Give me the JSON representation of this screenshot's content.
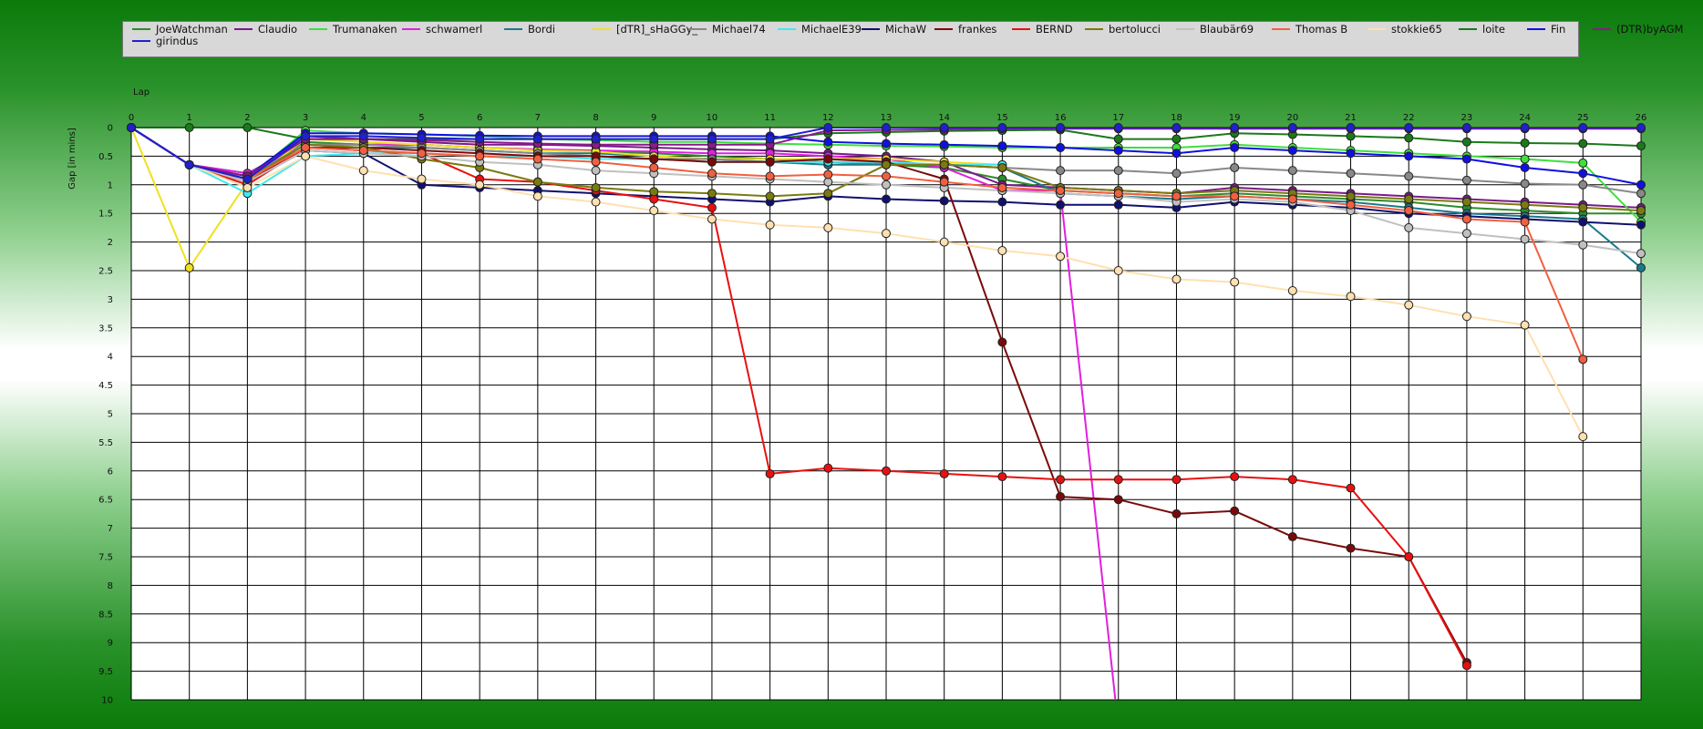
{
  "chart_data": {
    "type": "line",
    "xlabel": "Lap",
    "ylabel": "Gap [in mins]",
    "x": [
      0,
      1,
      2,
      3,
      4,
      5,
      6,
      7,
      8,
      9,
      10,
      11,
      12,
      13,
      14,
      15,
      16,
      17,
      18,
      19,
      20,
      21,
      22,
      23,
      24,
      25,
      26
    ],
    "xlim": [
      0,
      26
    ],
    "ylim": [
      0,
      10
    ],
    "y_inverted": true,
    "y_ticks": [
      "0",
      "0.5",
      "1",
      "1.5",
      "2",
      "2.5",
      "3",
      "3.5",
      "4",
      "4.5",
      "5",
      "5.5",
      "6",
      "6.5",
      "7",
      "7.5",
      "8",
      "8.5",
      "9",
      "9.5",
      "10"
    ],
    "grid": true,
    "legend_position": "top",
    "series": [
      {
        "name": "JoeWatchman",
        "color": "#2e8b2e",
        "values": [
          0,
          0.65,
          0.8,
          0.25,
          0.3,
          0.3,
          0.35,
          0.4,
          0.42,
          0.45,
          0.5,
          0.55,
          0.6,
          0.65,
          0.7,
          0.9,
          1.1,
          1.15,
          1.2,
          1.15,
          1.2,
          1.25,
          1.3,
          1.4,
          1.45,
          1.5,
          1.5
        ]
      },
      {
        "name": "Claudio",
        "color": "#7a1a8a",
        "values": [
          0,
          0.65,
          0.85,
          0.15,
          0.2,
          0.25,
          0.3,
          0.3,
          0.32,
          0.35,
          0.38,
          0.4,
          0.45,
          0.5,
          0.6,
          1.0,
          1.05,
          1.1,
          1.15,
          1.05,
          1.1,
          1.15,
          1.2,
          1.25,
          1.3,
          1.35,
          1.4
        ]
      },
      {
        "name": "Trumanaken",
        "color": "#3de03d",
        "values": [
          0,
          0.65,
          0.9,
          0.05,
          0.1,
          0.12,
          0.15,
          0.2,
          0.22,
          0.25,
          0.25,
          0.28,
          0.3,
          0.32,
          0.33,
          0.35,
          0.35,
          0.35,
          0.35,
          0.3,
          0.35,
          0.4,
          0.45,
          0.5,
          0.55,
          0.62,
          1.65
        ]
      },
      {
        "name": "schwamerl",
        "color": "#e020e0",
        "values": [
          0,
          0.65,
          0.8,
          0.3,
          0.3,
          0.3,
          0.35,
          0.38,
          0.4,
          0.42,
          0.45,
          0.45,
          0.5,
          0.55,
          0.7,
          1.1,
          1.1,
          10.5,
          null,
          null,
          null,
          null,
          null,
          null,
          null,
          null,
          null
        ]
      },
      {
        "name": "Bordi",
        "color": "#1a7a8a",
        "values": [
          0,
          0.65,
          0.9,
          0.3,
          0.35,
          0.35,
          0.4,
          0.45,
          0.45,
          0.5,
          0.55,
          0.6,
          0.65,
          0.65,
          0.65,
          0.7,
          1.15,
          1.2,
          1.25,
          1.2,
          1.25,
          1.3,
          1.4,
          1.5,
          1.55,
          1.6,
          2.45
        ]
      },
      {
        "name": "[dTR]_sHaGGy_",
        "color": "#f0e020",
        "values": [
          0,
          2.45,
          0.95,
          0.2,
          0.25,
          0.3,
          0.35,
          0.4,
          0.42,
          0.5,
          0.55,
          0.55,
          0.55,
          0.55,
          0.6,
          0.65,
          null,
          null,
          null,
          null,
          null,
          null,
          null,
          null,
          null,
          null,
          null
        ]
      },
      {
        "name": "Michael74",
        "color": "#888888",
        "values": [
          0,
          0.65,
          0.85,
          0.3,
          0.3,
          0.35,
          0.4,
          0.45,
          0.5,
          0.55,
          0.55,
          0.6,
          0.6,
          0.62,
          0.65,
          0.7,
          0.75,
          0.75,
          0.8,
          0.7,
          0.75,
          0.8,
          0.85,
          0.92,
          0.98,
          1.0,
          1.15
        ]
      },
      {
        "name": "MichaelE39",
        "color": "#40e8f0",
        "values": [
          0,
          0.65,
          1.15,
          0.5,
          0.45,
          0.45,
          0.5,
          0.5,
          0.55,
          0.55,
          0.6,
          0.6,
          0.6,
          0.6,
          0.65,
          0.65,
          null,
          null,
          null,
          null,
          null,
          null,
          null,
          null,
          null,
          null,
          null
        ]
      },
      {
        "name": "MichaW",
        "color": "#101070",
        "values": [
          0,
          0.65,
          0.95,
          0.4,
          0.45,
          1.0,
          1.05,
          1.1,
          1.15,
          1.2,
          1.25,
          1.3,
          1.2,
          1.25,
          1.28,
          1.3,
          1.35,
          1.35,
          1.4,
          1.3,
          1.35,
          1.4,
          1.5,
          1.55,
          1.6,
          1.65,
          1.7
        ]
      },
      {
        "name": "frankes",
        "color": "#7a0a0a",
        "values": [
          0,
          0.65,
          0.95,
          0.35,
          0.35,
          0.4,
          0.45,
          0.5,
          0.5,
          0.55,
          0.6,
          0.6,
          0.55,
          0.6,
          0.9,
          3.75,
          6.45,
          6.5,
          6.75,
          6.7,
          7.15,
          7.35,
          7.5,
          9.35,
          null,
          null,
          null
        ]
      },
      {
        "name": "BERND",
        "color": "#e81010",
        "values": [
          0,
          0.65,
          1.0,
          0.35,
          0.4,
          0.45,
          0.9,
          0.95,
          1.1,
          1.25,
          1.4,
          6.05,
          5.95,
          6.0,
          6.05,
          6.1,
          6.15,
          6.15,
          6.15,
          6.1,
          6.15,
          6.3,
          7.5,
          9.4,
          null,
          null,
          null
        ]
      },
      {
        "name": "bertolucci",
        "color": "#7a7a10",
        "values": [
          0,
          0.65,
          0.9,
          0.3,
          0.35,
          0.55,
          0.7,
          0.95,
          1.05,
          1.12,
          1.15,
          1.2,
          1.15,
          0.65,
          0.65,
          0.7,
          1.05,
          1.1,
          1.15,
          1.1,
          1.15,
          1.2,
          1.25,
          1.3,
          1.35,
          1.4,
          1.45
        ]
      },
      {
        "name": "Blaubär69",
        "color": "#c0c0c0",
        "values": [
          0,
          0.65,
          0.95,
          0.4,
          0.45,
          0.5,
          0.6,
          0.65,
          0.75,
          0.8,
          0.85,
          0.9,
          0.95,
          1.0,
          1.05,
          1.1,
          1.15,
          1.2,
          1.3,
          1.25,
          1.3,
          1.45,
          1.75,
          1.85,
          1.95,
          2.05,
          2.2
        ]
      },
      {
        "name": "Thomas B",
        "color": "#f06040",
        "values": [
          0,
          0.65,
          0.9,
          0.35,
          0.4,
          0.45,
          0.5,
          0.55,
          0.6,
          0.7,
          0.8,
          0.85,
          0.82,
          0.85,
          0.95,
          1.05,
          1.1,
          1.15,
          1.2,
          1.2,
          1.25,
          1.35,
          1.45,
          1.6,
          1.65,
          4.05,
          null
        ]
      },
      {
        "name": "stokkie65",
        "color": "#ffe0b0",
        "values": [
          0,
          0.65,
          1.05,
          0.5,
          0.75,
          0.9,
          1.0,
          1.2,
          1.3,
          1.45,
          1.6,
          1.7,
          1.75,
          1.85,
          2.0,
          2.15,
          2.25,
          2.5,
          2.65,
          2.7,
          2.85,
          2.95,
          3.1,
          3.3,
          3.45,
          5.4,
          null
        ]
      },
      {
        "name": "loite",
        "color": "#1a7a1a",
        "values": [
          0,
          0,
          0,
          0.2,
          0.2,
          0.2,
          0.2,
          0.2,
          0.2,
          0.2,
          0.2,
          0.2,
          0.1,
          0.08,
          0.06,
          0.05,
          0.04,
          0.2,
          0.2,
          0.1,
          0.12,
          0.15,
          0.18,
          0.25,
          0.27,
          0.28,
          0.32
        ]
      },
      {
        "name": "Fin",
        "color": "#1010e0",
        "values": [
          0,
          0.65,
          0.85,
          0.1,
          0.1,
          0.12,
          0.14,
          0.15,
          0.15,
          0.15,
          0.15,
          0.15,
          0.25,
          0.28,
          0.3,
          0.32,
          0.35,
          0.4,
          0.45,
          0.35,
          0.4,
          0.45,
          0.5,
          0.55,
          0.7,
          0.8,
          1.0
        ]
      },
      {
        "name": "(DTR)byAGM",
        "color": "#8a1a8a",
        "values": [
          0,
          0.65,
          0.85,
          0.2,
          0.2,
          0.22,
          0.25,
          0.28,
          0.3,
          0.3,
          0.3,
          0.3,
          0.05,
          0.04,
          0.03,
          0.02,
          0.02,
          0.02,
          0.02,
          0.02,
          0.02,
          0.02,
          0.02,
          0.02,
          0.02,
          0.02,
          0.02
        ]
      },
      {
        "name": "girindus",
        "color": "#2020d0",
        "values": [
          0,
          0.65,
          0.9,
          0.15,
          0.15,
          0.18,
          0.2,
          0.2,
          0.2,
          0.2,
          0.2,
          0.2,
          0.0,
          0.0,
          0.0,
          0.0,
          0.0,
          0.0,
          0.0,
          0.0,
          0.0,
          0.0,
          0.0,
          0.0,
          0.0,
          0.0,
          0.0
        ]
      }
    ]
  }
}
